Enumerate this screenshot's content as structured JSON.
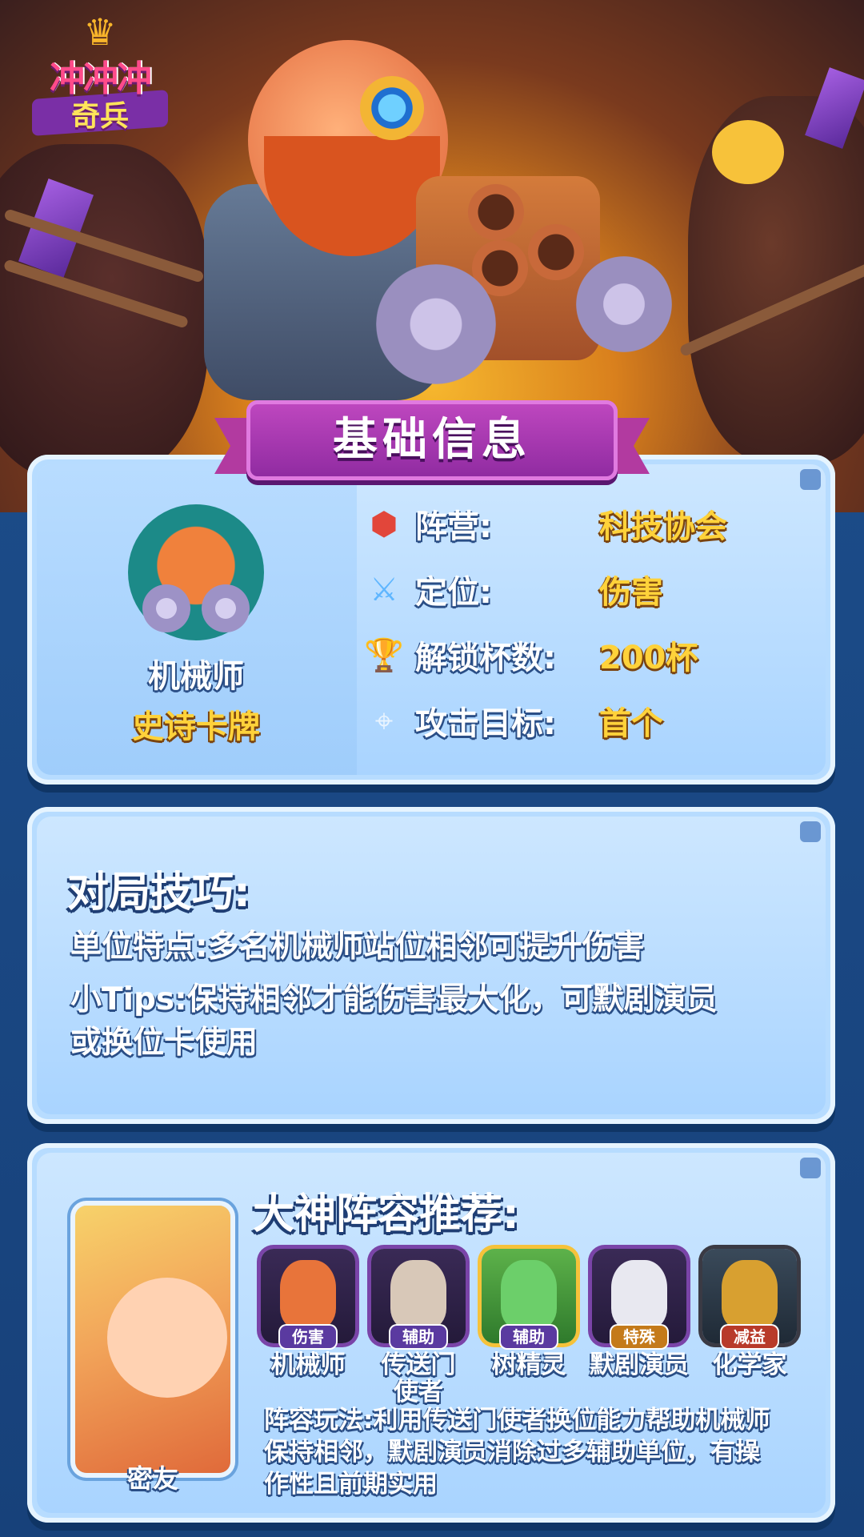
{
  "logo": {
    "line1": "冲冲冲",
    "line2": "奇兵"
  },
  "banner": {
    "title": "基础信息"
  },
  "unit": {
    "name": "机械师",
    "rarity": "史诗卡牌"
  },
  "info_rows": [
    {
      "icon": "faction-icon",
      "label": "阵营:",
      "value": "科技协会"
    },
    {
      "icon": "sword-icon",
      "label": "定位:",
      "value": "伤害"
    },
    {
      "icon": "trophy-icon",
      "label": "解锁杯数:",
      "value": "200杯"
    },
    {
      "icon": "target-icon",
      "label": "攻击目标:",
      "value": "首个"
    }
  ],
  "tips": {
    "title": "对局技巧:",
    "feature": "单位特点:多名机械师站位相邻可提升伤害",
    "tip_line1": "小Tips:保持相邻才能伤害最大化，可默剧演员",
    "tip_line2": "或换位卡使用"
  },
  "lineup": {
    "title": "大神阵容推荐:",
    "partner_label": "密友",
    "members": [
      {
        "name": "机械师",
        "role": "伤害"
      },
      {
        "name_line1": "传送门",
        "name_line2": "使者",
        "role": "辅助"
      },
      {
        "name": "树精灵",
        "role": "辅助"
      },
      {
        "name": "默剧演员",
        "role": "特殊"
      },
      {
        "name": "化学家",
        "role": "减益"
      }
    ],
    "desc_line1": "阵容玩法:利用传送门使者换位能力帮助机械师",
    "desc_line2": "保持相邻，默剧演员消除过多辅助单位，有操",
    "desc_line3": "作性且前期实用"
  },
  "colors": {
    "accent_gold": "#ffd23a",
    "panel_blue": "#b7dcff",
    "banner_purple": "#a13ab0"
  }
}
